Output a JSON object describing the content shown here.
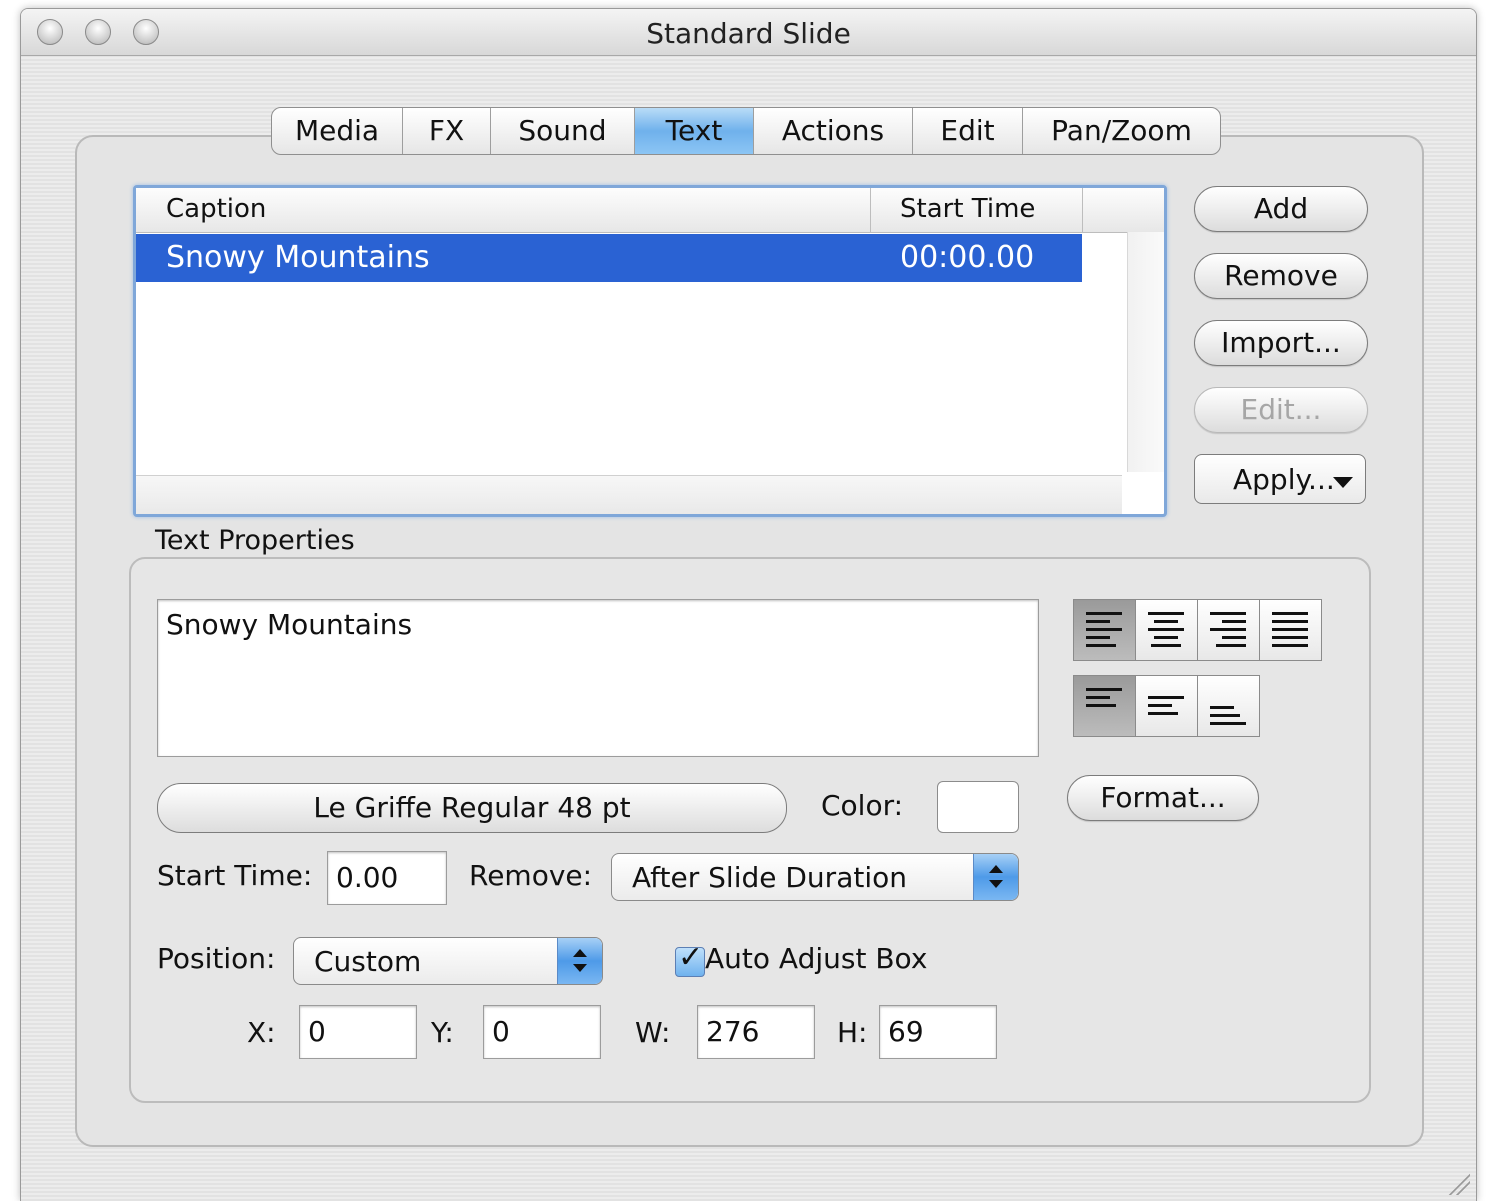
{
  "window": {
    "title": "Standard Slide"
  },
  "tabs": [
    {
      "label": "Media"
    },
    {
      "label": "FX"
    },
    {
      "label": "Sound"
    },
    {
      "label": "Text",
      "active": true
    },
    {
      "label": "Actions"
    },
    {
      "label": "Edit"
    },
    {
      "label": "Pan/Zoom"
    }
  ],
  "caption_list": {
    "columns": [
      "Caption",
      "Start Time"
    ],
    "rows": [
      {
        "caption": "Snowy Mountains",
        "start_time": "00:00.00",
        "selected": true
      }
    ]
  },
  "side_buttons": {
    "add": "Add",
    "remove": "Remove",
    "import": "Import...",
    "edit": "Edit...",
    "apply": "Apply..."
  },
  "text_properties": {
    "group_label": "Text Properties",
    "text_value": "Snowy Mountains",
    "font_button": "Le Griffe Regular 48 pt",
    "color_label": "Color:",
    "color_value": "#ffffff",
    "format_button": "Format...",
    "start_time_label": "Start Time:",
    "start_time_value": "0.00",
    "remove_label": "Remove:",
    "remove_value": "After Slide Duration",
    "position_label": "Position:",
    "position_value": "Custom",
    "auto_adjust_label": "Auto Adjust Box",
    "auto_adjust_checked": true,
    "x_label": "X:",
    "x_value": "0",
    "y_label": "Y:",
    "y_value": "0",
    "w_label": "W:",
    "w_value": "276",
    "h_label": "H:",
    "h_value": "69",
    "horizontal_alignment": [
      "left",
      "center",
      "right",
      "justify"
    ],
    "horizontal_selected": "left",
    "vertical_alignment": [
      "top",
      "middle",
      "bottom"
    ],
    "vertical_selected": "top"
  },
  "colors": {
    "selection": "#2a62d3",
    "active_tab": "#6fb1ec"
  }
}
